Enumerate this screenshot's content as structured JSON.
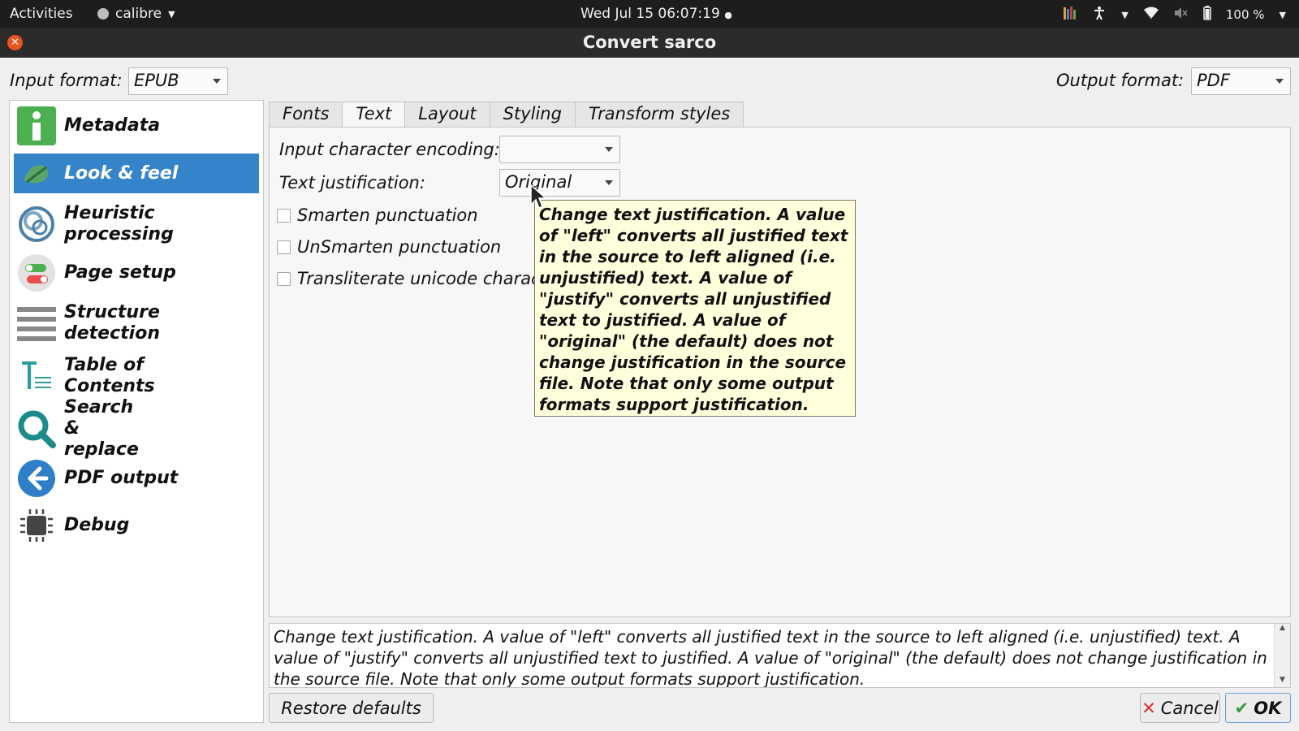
{
  "topbar": {
    "activities": "Activities",
    "app_name": "calibre",
    "clock": "Wed Jul 15  06:07:19",
    "battery": "100 %"
  },
  "window": {
    "title": "Convert sarco"
  },
  "formats": {
    "input_label": "Input format:",
    "input_value": "EPUB",
    "output_label": "Output format:",
    "output_value": "PDF"
  },
  "sidebar": {
    "items": [
      {
        "label": "Metadata",
        "icon": "info-icon"
      },
      {
        "label": "Look & feel",
        "icon": "look-feel-icon",
        "active": true
      },
      {
        "label": "Heuristic processing",
        "icon": "heuristic-icon"
      },
      {
        "label": "Page setup",
        "icon": "page-setup-icon"
      },
      {
        "label": "Structure detection",
        "icon": "structure-icon"
      },
      {
        "label": "Table of Contents",
        "icon": "toc-icon"
      },
      {
        "label": "Search & replace",
        "icon": "search-icon"
      },
      {
        "label": "PDF output",
        "icon": "pdf-output-icon"
      },
      {
        "label": "Debug",
        "icon": "debug-icon"
      }
    ]
  },
  "tabs": [
    "Fonts",
    "Text",
    "Layout",
    "Styling",
    "Transform styles"
  ],
  "text_tab": {
    "encoding_label": "Input character encoding:",
    "encoding_value": "",
    "justification_label": "Text justification:",
    "justification_value": "Original",
    "checkboxes": [
      {
        "label": "Smarten punctuation",
        "checked": false
      },
      {
        "label": "UnSmarten punctuation",
        "checked": false
      },
      {
        "label": "Transliterate unicode charac",
        "checked": false
      }
    ]
  },
  "tooltip": "Change text justification. A value of \"left\" converts all justified text in the source to left aligned (i.e. unjustified) text. A value of \"justify\" converts all unjustified text to justified. A value of \"original\" (the default) does not change justification in the source file. Note that only some output formats support justification.",
  "help_text": "Change text justification. A value of \"left\" converts all justified text in the source to left aligned (i.e. unjustified) text. A value of \"justify\" converts all unjustified text to justified. A value of \"original\" (the default) does not change justification in the source file. Note that only some output formats support justification.",
  "buttons": {
    "restore": "Restore defaults",
    "cancel": "Cancel",
    "ok": "OK"
  },
  "colors": {
    "accent": "#3584c9",
    "tooltip_bg": "#ffffdc",
    "topbar": "#1d1d1d"
  }
}
